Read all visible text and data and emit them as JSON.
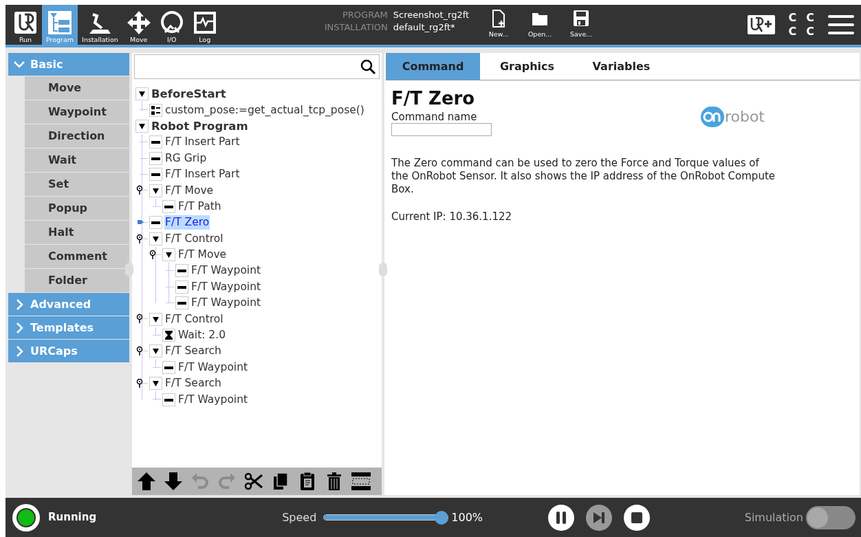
{
  "top_nav": [
    {
      "label": "Run",
      "kind": "run",
      "selected": false
    },
    {
      "label": "Program",
      "kind": "program",
      "selected": true
    },
    {
      "label": "Installation",
      "kind": "installation",
      "selected": false
    },
    {
      "label": "Move",
      "kind": "move",
      "selected": false
    },
    {
      "label": "I/O",
      "kind": "io",
      "selected": false
    },
    {
      "label": "Log",
      "kind": "log",
      "selected": false
    }
  ],
  "program_info": {
    "program_label": "PROGRAM",
    "program_value": "Screenshot_rg2ft",
    "installation_label": "INSTALLATION",
    "installation_value": "default_rg2ft*"
  },
  "file_buttons": [
    {
      "label": "New...",
      "kind": "new"
    },
    {
      "label": "Open...",
      "kind": "open"
    },
    {
      "label": "Save...",
      "kind": "save"
    }
  ],
  "status_letters": [
    "C",
    "C",
    "C",
    "C"
  ],
  "sidebar": {
    "sections": [
      {
        "label": "Basic",
        "expanded": true,
        "items": [
          "Move",
          "Waypoint",
          "Direction",
          "Wait",
          "Set",
          "Popup",
          "Halt",
          "Comment",
          "Folder"
        ]
      },
      {
        "label": "Advanced",
        "expanded": false
      },
      {
        "label": "Templates",
        "expanded": false
      },
      {
        "label": "URCaps",
        "expanded": false
      }
    ]
  },
  "tree": {
    "nodes": [
      {
        "label": "BeforeStart",
        "kind": "section",
        "selected": false,
        "expanded": true,
        "children": [
          {
            "label": "custom_pose:=get_actual_tcp_pose()",
            "kind": "assign",
            "selected": false,
            "current": false
          }
        ]
      },
      {
        "label": "Robot Program",
        "kind": "section",
        "selected": false,
        "expanded": true,
        "children": [
          {
            "label": "F/T Insert Part",
            "kind": "command",
            "selected": false,
            "current": false
          },
          {
            "label": "RG Grip",
            "kind": "command",
            "selected": false,
            "current": false
          },
          {
            "label": "F/T Insert Part",
            "kind": "command",
            "selected": false,
            "current": false
          },
          {
            "label": "F/T Move",
            "kind": "container",
            "selected": false,
            "current": false,
            "expanded": true,
            "children": [
              {
                "label": "F/T Path",
                "kind": "command",
                "selected": false,
                "current": false
              }
            ]
          },
          {
            "label": "F/T Zero",
            "kind": "command",
            "selected": true,
            "current": true
          },
          {
            "label": "F/T Control",
            "kind": "container",
            "selected": false,
            "current": false,
            "expanded": true,
            "children": [
              {
                "label": "F/T Move",
                "kind": "container",
                "selected": false,
                "current": false,
                "expanded": true,
                "children": [
                  {
                    "label": "F/T Waypoint",
                    "kind": "command",
                    "selected": false,
                    "current": false
                  },
                  {
                    "label": "F/T Waypoint",
                    "kind": "command",
                    "selected": false,
                    "current": false
                  },
                  {
                    "label": "F/T Waypoint",
                    "kind": "command",
                    "selected": false,
                    "current": false
                  }
                ]
              }
            ]
          },
          {
            "label": "F/T Control",
            "kind": "container",
            "selected": false,
            "current": false,
            "expanded": true,
            "children": [
              {
                "label": "Wait: 2.0",
                "kind": "wait",
                "selected": false,
                "current": false
              }
            ]
          },
          {
            "label": "F/T Search",
            "kind": "container",
            "selected": false,
            "current": false,
            "expanded": true,
            "children": [
              {
                "label": "F/T Waypoint",
                "kind": "command",
                "selected": false,
                "current": false
              }
            ]
          },
          {
            "label": "F/T Search",
            "kind": "container",
            "selected": false,
            "current": false,
            "expanded": true,
            "children": [
              {
                "label": "F/T Waypoint",
                "kind": "command",
                "selected": false,
                "current": false
              }
            ]
          }
        ]
      }
    ]
  },
  "tree_toolbar": [
    {
      "kind": "up",
      "disabled": false
    },
    {
      "kind": "down",
      "disabled": false
    },
    {
      "kind": "undo",
      "disabled": true
    },
    {
      "kind": "redo",
      "disabled": true
    },
    {
      "kind": "cut",
      "disabled": false
    },
    {
      "kind": "copy",
      "disabled": false
    },
    {
      "kind": "paste",
      "disabled": false
    },
    {
      "kind": "delete",
      "disabled": false
    },
    {
      "kind": "suppress",
      "disabled": false
    }
  ],
  "tabs": [
    {
      "label": "Command",
      "selected": true
    },
    {
      "label": "Graphics",
      "selected": false
    },
    {
      "label": "Variables",
      "selected": false
    }
  ],
  "command": {
    "title": "F/T Zero",
    "field_label": "Command name",
    "logo_text": "robot",
    "description": "The Zero command can be used to zero the Force and Torque values of the OnRobot Sensor. It also shows the IP address of the OnRobot Compute Box.",
    "ip": "Current IP: 10.36.1.122"
  },
  "status_bar": {
    "state": "Running",
    "running": true,
    "speed_label": "Speed",
    "speed": {
      "level": 1.0
    },
    "speed_reading": "100%",
    "controls": [
      {
        "kind": "pause",
        "disabled": false
      },
      {
        "kind": "step",
        "disabled": true
      },
      {
        "kind": "stop",
        "disabled": false
      }
    ],
    "simulation_label": "Simulation",
    "simulation_on": false
  }
}
